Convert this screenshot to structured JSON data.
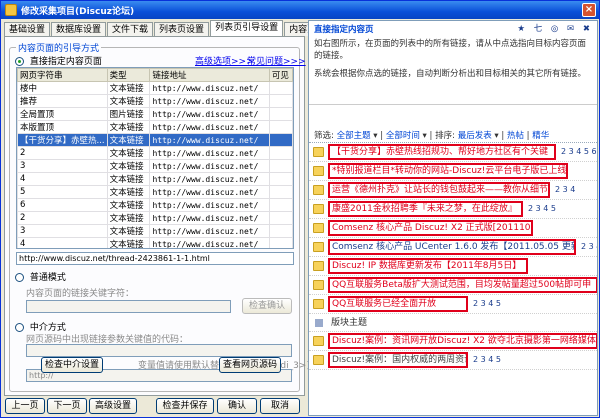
{
  "window": {
    "title": "修改采集项目(Discuz论坛)",
    "close": "×"
  },
  "tabs": [
    "基础设置",
    "数据库设置",
    "文件下载",
    "列表页设置",
    "列表页引导设置",
    "内容页面设置"
  ],
  "left": {
    "group_title": "内容页面的引导方式",
    "direct": {
      "label": "直接指定内容页面",
      "link1": "高级选项>>>",
      "link2": "常见问题>>>"
    },
    "table": {
      "headers": [
        "网页字符串",
        "类型",
        "链接地址",
        "可见"
      ],
      "rows": [
        {
          "name": "楼中",
          "type": "文本链接",
          "url": "http://www.discuz.net/",
          "vis": ""
        },
        {
          "name": "推荐",
          "type": "文本链接",
          "url": "http://www.discuz.net/",
          "vis": ""
        },
        {
          "name": "全局置顶",
          "type": "图片链接",
          "url": "http://www.discuz.net/",
          "vis": ""
        },
        {
          "name": "本版置顶",
          "type": "文本链接",
          "url": "http://www.discuz.net/",
          "vis": ""
        },
        {
          "name": "【干货分享】赤壁热...",
          "type": "文本链接",
          "url": "http://www.discuz.net/",
          "vis": ""
        },
        {
          "name": "2",
          "type": "文本链接",
          "url": "http://www.discuz.net/",
          "vis": ""
        },
        {
          "name": "3",
          "type": "文本链接",
          "url": "http://www.discuz.net/",
          "vis": ""
        },
        {
          "name": "4",
          "type": "文本链接",
          "url": "http://www.discuz.net/",
          "vis": ""
        },
        {
          "name": "5",
          "type": "文本链接",
          "url": "http://www.discuz.net/",
          "vis": ""
        },
        {
          "name": "6",
          "type": "文本链接",
          "url": "http://www.discuz.net/",
          "vis": ""
        },
        {
          "name": "2",
          "type": "文本链接",
          "url": "http://www.discuz.net/",
          "vis": ""
        },
        {
          "name": "3",
          "type": "文本链接",
          "url": "http://www.discuz.net/",
          "vis": ""
        },
        {
          "name": "4",
          "type": "文本链接",
          "url": "http://www.discuz.net/",
          "vis": ""
        }
      ],
      "selected_index": 4
    },
    "url_field": "http://www.discuz.net/thread-2423861-1-1.html",
    "normal": {
      "label": "普通模式",
      "caption": "内容页面的链接关键字符：",
      "button": "检查确认"
    },
    "middle": {
      "label": "中介方式",
      "caption": "网页源码中出现链接参数关键值的代码：",
      "var_label": "变量值请使用默认替换代码：",
      "var_code": "[<madi_3>]",
      "prefix": "http://",
      "btn_check": "检查中介设置",
      "btn_source": "查看网页源码"
    }
  },
  "bottom": [
    "上一页",
    "下一页",
    "高级设置",
    "检查并保存",
    "确认",
    "取消"
  ],
  "right": {
    "help": {
      "title": "直接指定内容页",
      "tools": "★ 七 ◎ ✉ ✖",
      "body1": "如右图所示，在页面的列表中的所有链接，请从中点选指向目标内容页面的链接。",
      "body2": "系统会根据你点选的链接，自动判断分析出和目标相关的其它所有链接。"
    },
    "filter": {
      "prefix": "筛选:",
      "all_subjects": "全部主题",
      "all_time": "全部时间",
      "sort": "排序:",
      "latest": "最后发表",
      "hot": "热帖",
      "elite": "精华"
    },
    "threads": [
      {
        "title": "【干货分享】赤壁热线招规功、帮好地方社区有个关键",
        "color": "red",
        "pages": "2 3 4 5 6 ... 16"
      },
      {
        "title": "*特别报道栏目*转动你的网站-Discuz!云平台电子版已上线",
        "color": "red",
        "pages": ""
      },
      {
        "title": "运营《德州扑克》让站长的钱包鼓起来——教你从细节入手",
        "color": "red",
        "pages": "2 3 4"
      },
      {
        "title": "康盛2011金秋招聘季『未来之梦，在此绽放』",
        "color": "red",
        "pages": "2 3 4 5"
      },
      {
        "title": "Comsenz 核心产品 Discuz! X2 正式版[20111010]",
        "color": "red",
        "pages": ""
      },
      {
        "title": "Comsenz 核心产品 UCenter 1.6.0 发布【2011.05.05 更新】",
        "color": "blue",
        "pages": "2 3 4 5"
      },
      {
        "title": "Discuz! IP 数据库更新发布【2011年8月5日】",
        "color": "red",
        "pages": ""
      },
      {
        "title": "QQ互联服务Beta版扩大测试范围，目均发帖量超过500帖即可申",
        "color": "red",
        "pages": ""
      },
      {
        "title": "QQ互联服务已经全面开放",
        "color": "red",
        "pages": "2 3 4 5"
      }
    ],
    "section_label": "版块主题",
    "threads2": [
      {
        "title": "Discuz!案例：资讯网开放Discuz! X2 欲夺北京摄影第一网络媒体",
        "color": "red",
        "pages": ""
      },
      {
        "title": "Discuz!案例：国内权威的两周资讯",
        "color": "dark",
        "pages": "2 3 4 5"
      }
    ]
  }
}
